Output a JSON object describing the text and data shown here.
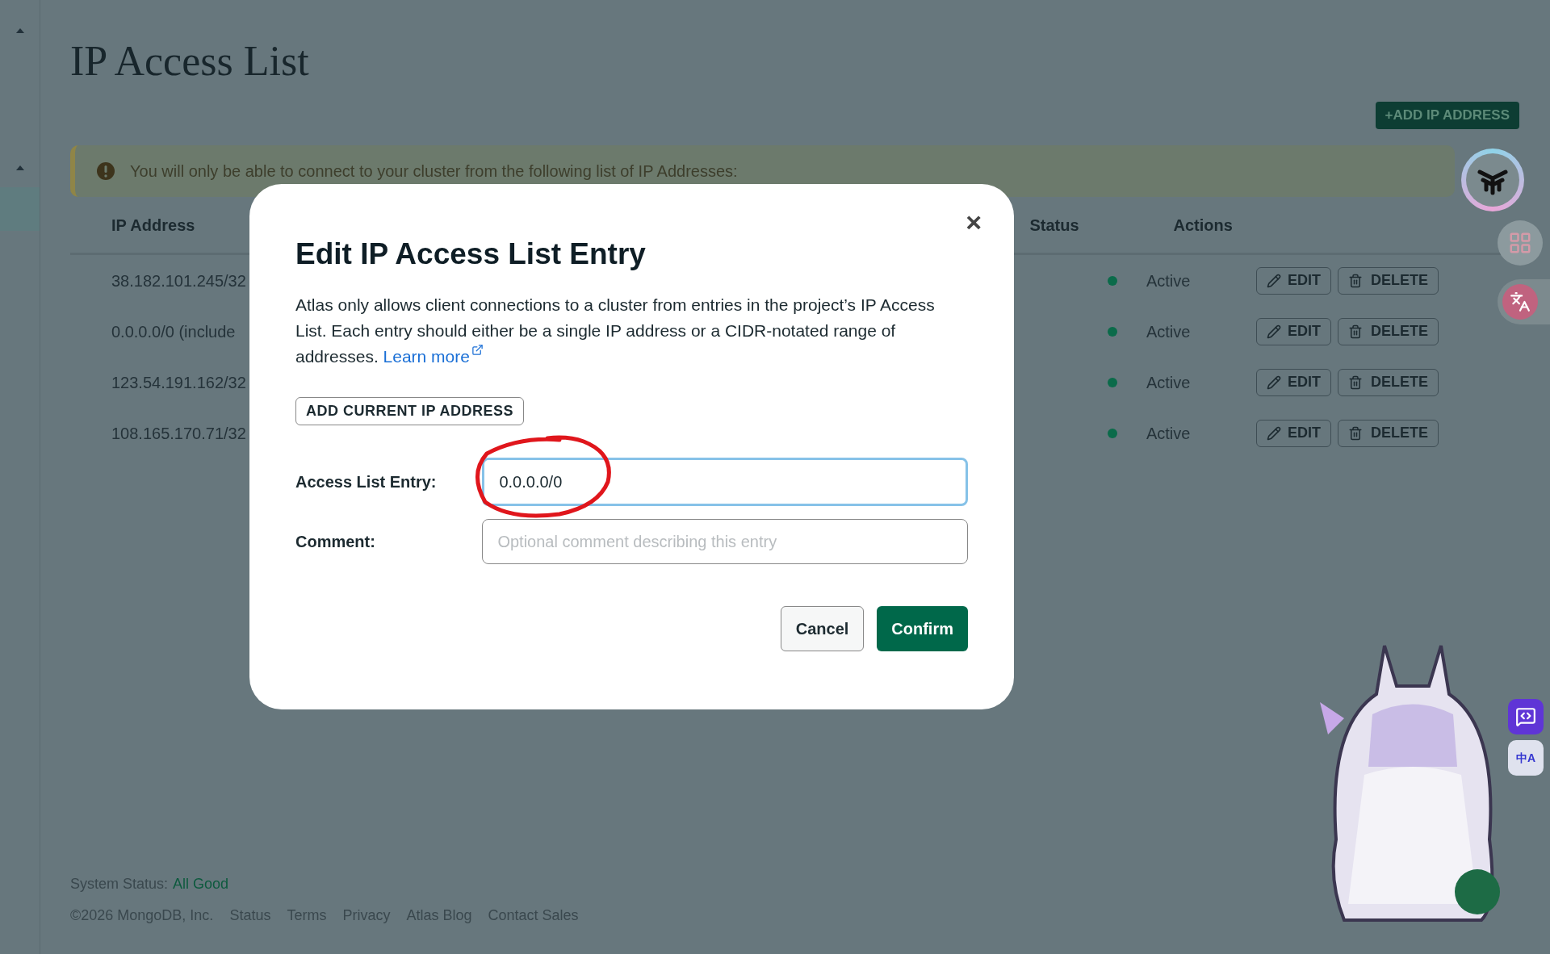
{
  "page": {
    "title": "IP Access List",
    "add_button": "+ADD IP ADDRESS",
    "banner": "You will only be able to connect to your cluster from the following list of IP Addresses:"
  },
  "table": {
    "columns": [
      "IP Address",
      "Status",
      "Actions"
    ],
    "rows": [
      {
        "ip": "38.182.101.245/32",
        "status": "Active",
        "color": "#0b6b4a",
        "edit": "EDIT",
        "delete": "DELETE"
      },
      {
        "ip": "0.0.0.0/0 (include",
        "status": "Active",
        "color": "#0b6b4a",
        "edit": "EDIT",
        "delete": "DELETE"
      },
      {
        "ip": "123.54.191.162/32",
        "status": "Active",
        "color": "#0b6b4a",
        "edit": "EDIT",
        "delete": "DELETE"
      },
      {
        "ip": "108.165.170.71/32",
        "status": "Active",
        "color": "#0b6b4a",
        "edit": "EDIT",
        "delete": "DELETE"
      }
    ]
  },
  "footer": {
    "status_label": "System Status:",
    "status_value": "All Good",
    "copyright": "©2026 MongoDB, Inc.",
    "links": [
      "Status",
      "Terms",
      "Privacy",
      "Atlas Blog",
      "Contact Sales"
    ]
  },
  "dialog": {
    "title": "Edit IP Access List Entry",
    "close": "×",
    "description": "Atlas only allows client connections to a cluster from entries in the project’s IP Access List. Each entry should either be a single IP address or a CIDR-notated range of addresses.",
    "learn_more": "Learn more",
    "add_current": "ADD CURRENT IP ADDRESS",
    "fields": [
      {
        "label": "Access List Entry:",
        "value": "0.0.0.0/0",
        "focused": true,
        "circled": true
      },
      {
        "label": "Comment:",
        "placeholder": "Optional comment describing this entry",
        "focused": false,
        "circled": false
      }
    ],
    "buttons": [
      {
        "label": "Cancel",
        "kind": "secondary"
      },
      {
        "label": "Confirm",
        "kind": "primary"
      }
    ]
  },
  "side_tools": {
    "translate_badge": "中A"
  }
}
